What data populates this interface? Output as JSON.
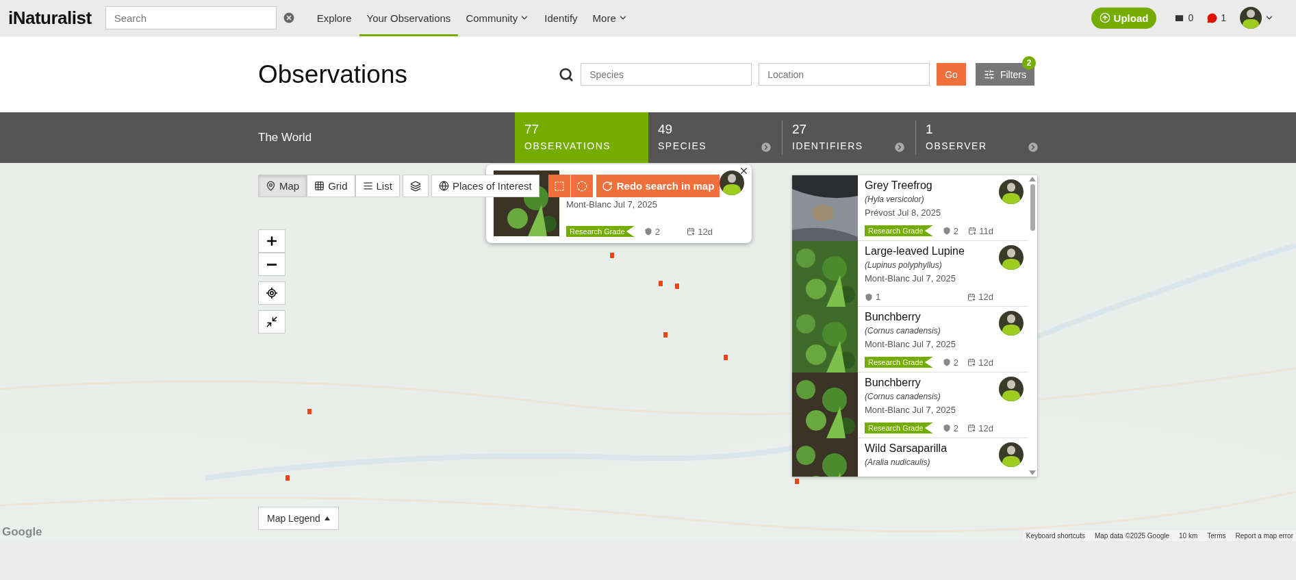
{
  "nav": {
    "logo": "iNaturalist",
    "search_placeholder": "Search",
    "links": [
      {
        "label": "Explore",
        "selected": false,
        "menu": false
      },
      {
        "label": "Your Observations",
        "selected": true,
        "menu": false
      },
      {
        "label": "Community",
        "selected": false,
        "menu": true
      },
      {
        "label": "Identify",
        "selected": false,
        "menu": false
      },
      {
        "label": "More",
        "selected": false,
        "menu": true
      }
    ],
    "upload": "Upload",
    "messages": "0",
    "notifications": "1"
  },
  "header": {
    "title": "Observations",
    "species_placeholder": "Species",
    "location_placeholder": "Location",
    "go": "Go",
    "filters": "Filters",
    "filters_count": "2"
  },
  "stats": {
    "place": "The World",
    "tabs": [
      {
        "count": "77",
        "label": "OBSERVATIONS",
        "selected": true
      },
      {
        "count": "49",
        "label": "SPECIES",
        "selected": false
      },
      {
        "count": "27",
        "label": "IDENTIFIERS",
        "selected": false
      },
      {
        "count": "1",
        "label": "OBSERVER",
        "selected": false
      }
    ]
  },
  "map": {
    "views": [
      {
        "label": "Map",
        "kind": "map",
        "selected": true
      },
      {
        "label": "Grid",
        "kind": "grid",
        "selected": false
      },
      {
        "label": "List",
        "kind": "list",
        "selected": false
      }
    ],
    "places": "Places of Interest",
    "redo": "Redo search in map",
    "legend": "Map Legend",
    "google": "Google",
    "attribution": [
      "Keyboard shortcuts",
      "Map data ©2025 Google",
      "10 km",
      "Terms",
      "Report a map error"
    ]
  },
  "popup": {
    "place_date": "Mont-Blanc Jul 7, 2025",
    "grade": "Research Grade",
    "ids": "2",
    "age": "12d"
  },
  "observations": [
    {
      "name": "Grey Treefrog",
      "scientific": "(Hyla versicolor)",
      "place_date": "Prévost Jul 8, 2025",
      "grade": "Research Grade",
      "ids": "2",
      "age": "11d"
    },
    {
      "name": "Large-leaved Lupine",
      "scientific": "(Lupinus polyphyllus)",
      "place_date": "Mont-Blanc Jul 7, 2025",
      "ids": "1",
      "age": "12d"
    },
    {
      "name": "Bunchberry",
      "scientific": "(Cornus canadensis)",
      "place_date": "Mont-Blanc Jul 7, 2025",
      "grade": "Research Grade",
      "ids": "2",
      "age": "12d"
    },
    {
      "name": "Bunchberry",
      "scientific": "(Cornus canadensis)",
      "place_date": "Mont-Blanc Jul 7, 2025",
      "grade": "Research Grade",
      "ids": "2",
      "age": "12d"
    },
    {
      "name": "Wild Sarsaparilla",
      "scientific": "(Aralia nudicaulis)"
    }
  ]
}
